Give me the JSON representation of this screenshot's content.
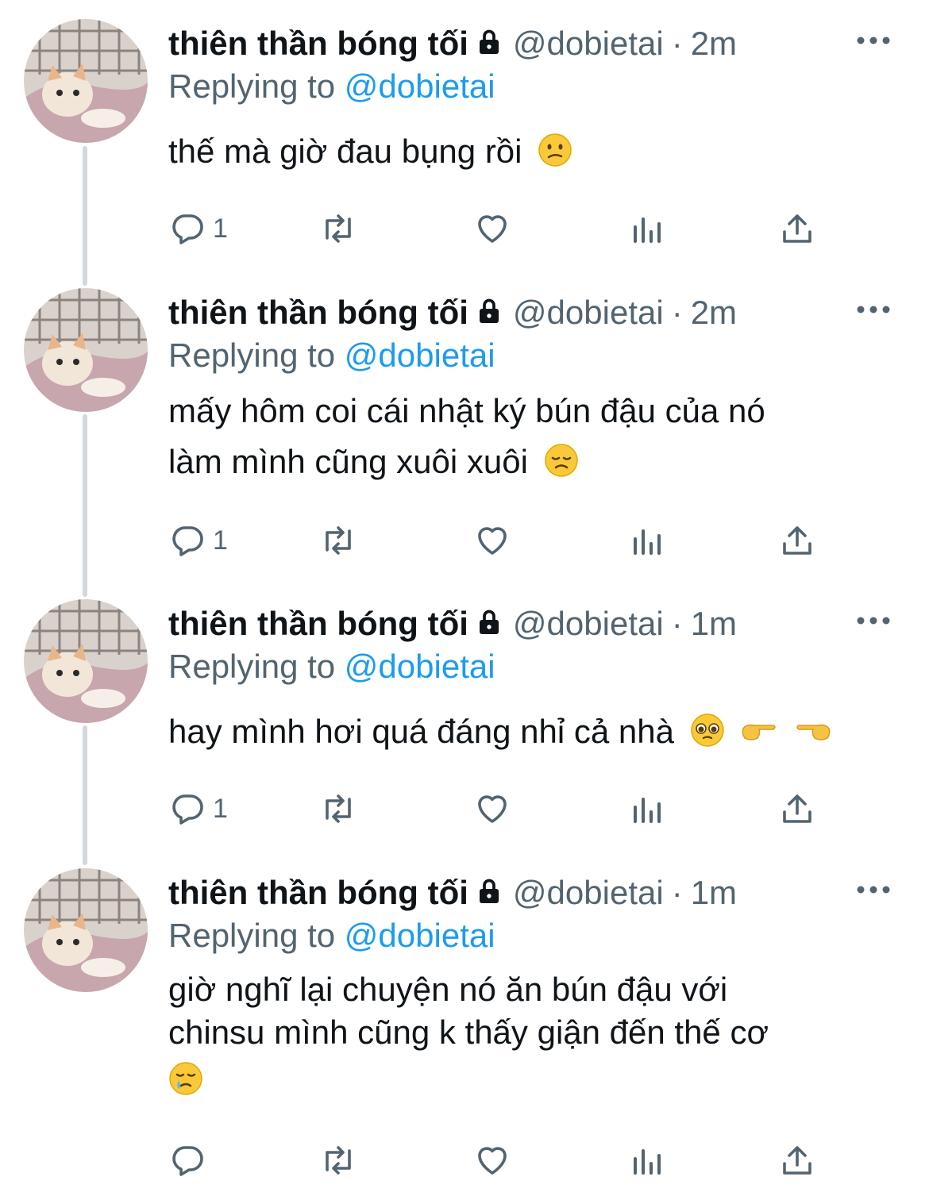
{
  "colors": {
    "text": "#0f1419",
    "muted": "#536471",
    "link": "#1d9bf0",
    "thread": "#cfd9de"
  },
  "tweets": [
    {
      "name": "thiên thần bóng tối",
      "handle": "@dobietai",
      "separator": "·",
      "time": "2m",
      "replying_prefix": "Replying to",
      "replying_to": "@dobietai",
      "lines": [
        "thế mà giờ đau bụng rồi"
      ],
      "emoji": [
        "confused-face"
      ],
      "reply_count": "1"
    },
    {
      "name": "thiên thần bóng tối",
      "handle": "@dobietai",
      "separator": "·",
      "time": "2m",
      "replying_prefix": "Replying to",
      "replying_to": "@dobietai",
      "lines": [
        "mấy hôm coi cái nhật ký bún đậu của nó",
        "làm mình cũng xuôi xuôi"
      ],
      "emoji": [
        "disappointed-face"
      ],
      "reply_count": "1"
    },
    {
      "name": "thiên thần bóng tối",
      "handle": "@dobietai",
      "separator": "·",
      "time": "1m",
      "replying_prefix": "Replying to",
      "replying_to": "@dobietai",
      "lines": [
        "hay mình hơi quá đáng nhỉ cả nhà"
      ],
      "emoji": [
        "pleading-face",
        "pointing-right",
        "pointing-left"
      ],
      "reply_count": "1"
    },
    {
      "name": "thiên thần bóng tối",
      "handle": "@dobietai",
      "separator": "·",
      "time": "1m",
      "replying_prefix": "Replying to",
      "replying_to": "@dobietai",
      "lines": [
        "giờ nghĩ lại chuyện nó ăn bún đậu với",
        "chinsu mình cũng k thấy giận đến thế cơ"
      ],
      "emoji": [
        "crying-face"
      ],
      "reply_count": ""
    }
  ]
}
